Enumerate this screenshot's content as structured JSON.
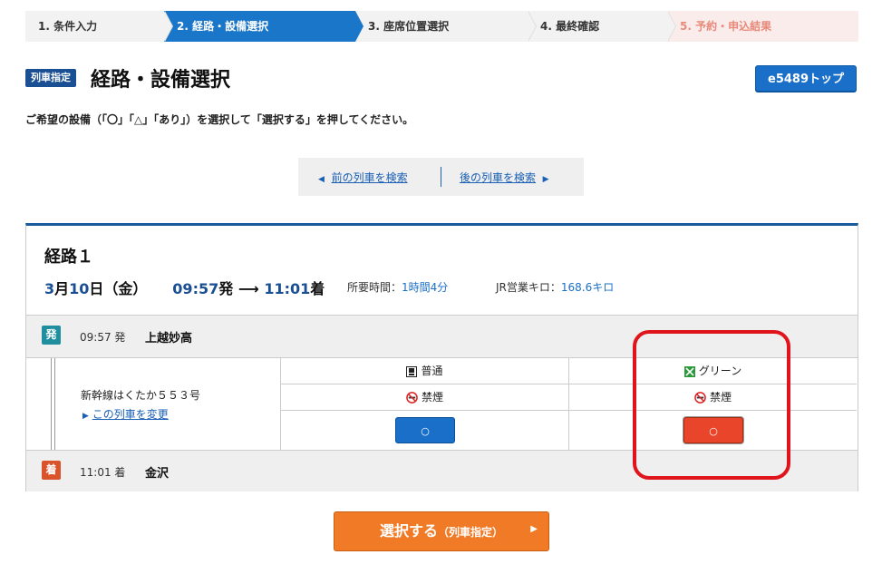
{
  "steps": [
    {
      "label": "1. 条件入力"
    },
    {
      "label": "2. 経路・設備選択"
    },
    {
      "label": "3. 座席位置選択"
    },
    {
      "label": "4. 最終確認"
    },
    {
      "label": "5. 予約・申込結果"
    }
  ],
  "header": {
    "badge": "列車指定",
    "title": "経路・設備選択",
    "top_button": "e5489トップ"
  },
  "instructions": "ご希望の設備（「〇」「△」「あり」）を選択して「選択する」を押してください。",
  "pager": {
    "prev_label": "前の列車を検索",
    "next_label": "後の列車を検索"
  },
  "route": {
    "title": "経路１",
    "date_month": "3",
    "month_unit": "月",
    "date_day": "10",
    "day_unit": "日（金）",
    "dep_time": "09:57",
    "dep_suffix": "発",
    "arr_time": "11:01",
    "arr_suffix": "着",
    "duration_label": "所要時間：",
    "duration_value": "1時間4分",
    "km_label": "JR営業キロ：",
    "km_value": "168.6キロ",
    "departure": {
      "icon": "発",
      "time": "09:57 発",
      "station": "上越妙高"
    },
    "arrival": {
      "icon": "着",
      "time": "11:01 着",
      "station": "金沢"
    },
    "train": {
      "name": "新幹線はくたか５５３号",
      "change_link": "この列車を変更"
    },
    "seat_classes": [
      {
        "type": "普通",
        "smoking": "禁煙",
        "availability": "○"
      },
      {
        "type": "グリーン",
        "smoking": "禁煙",
        "availability": "○"
      }
    ]
  },
  "select_button": {
    "main": "選択する",
    "sub": "（列車指定）"
  },
  "colors": {
    "accent": "#1a76c8",
    "highlight": "#e0151b",
    "select": "#f07a26"
  }
}
